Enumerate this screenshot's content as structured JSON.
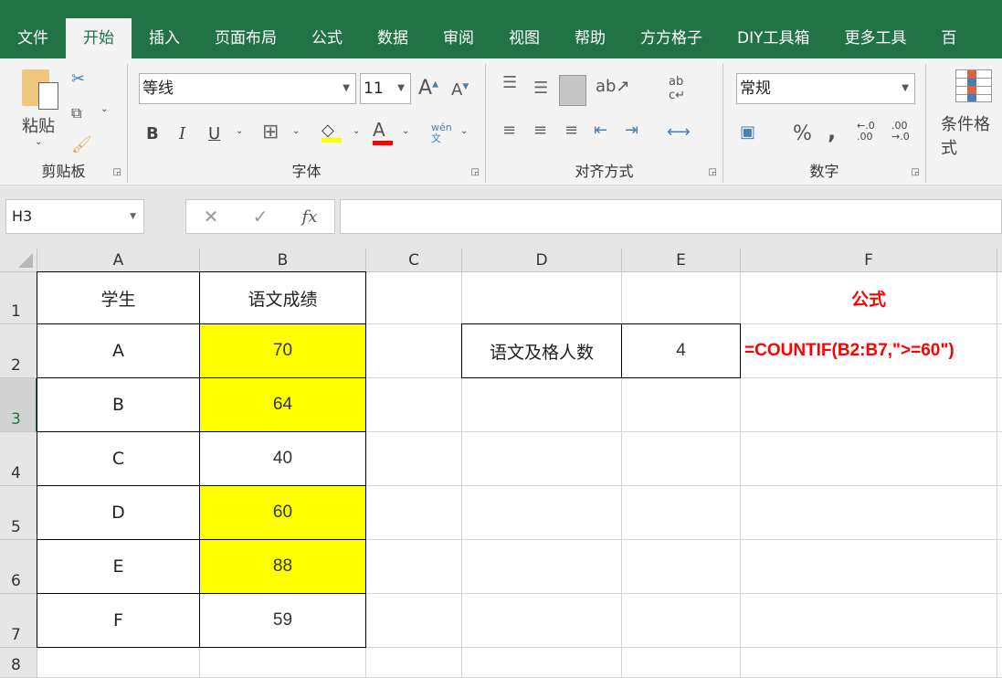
{
  "tabs": [
    "文件",
    "开始",
    "插入",
    "页面布局",
    "公式",
    "数据",
    "审阅",
    "视图",
    "帮助",
    "方方格子",
    "DIY工具箱",
    "更多工具",
    "百"
  ],
  "active_tab": 1,
  "ribbon": {
    "clipboard": {
      "label": "剪贴板",
      "paste": "粘贴"
    },
    "font": {
      "label": "字体",
      "name": "等线",
      "size": "11",
      "bold": "B",
      "italic": "I",
      "underline": "U",
      "phonetic": "wén 文"
    },
    "alignment": {
      "label": "对齐方式"
    },
    "number": {
      "label": "数字",
      "format": "常规",
      "percent": "%",
      "comma": ",",
      "inc_decimal": "←.0 .00",
      "dec_decimal": ".00 →.0"
    },
    "styles": {
      "conditional_format": "条件格式"
    },
    "colors": {
      "fill": "#ffff00",
      "font": "#ff0000"
    }
  },
  "formula_bar": {
    "name_box": "H3",
    "value": "",
    "fx": "fx"
  },
  "columns": [
    "A",
    "B",
    "C",
    "D",
    "E",
    "F"
  ],
  "rows": [
    "1",
    "2",
    "3",
    "4",
    "5",
    "6",
    "7",
    "8"
  ],
  "active_row": "3",
  "cells": {
    "A1": "学生",
    "B1": "语文成绩",
    "F1": "公式",
    "A2": "A",
    "B2": "70",
    "D2": "语文及格人数",
    "E2": "4",
    "F2": "=COUNTIF(B2:B7,\">=60\")",
    "A3": "B",
    "B3": "64",
    "A4": "C",
    "B4": "40",
    "A5": "D",
    "B5": "60",
    "A6": "E",
    "B6": "88",
    "A7": "F",
    "B7": "59"
  },
  "highlight_color": "#ffff00",
  "formula_color": "#ff0000"
}
